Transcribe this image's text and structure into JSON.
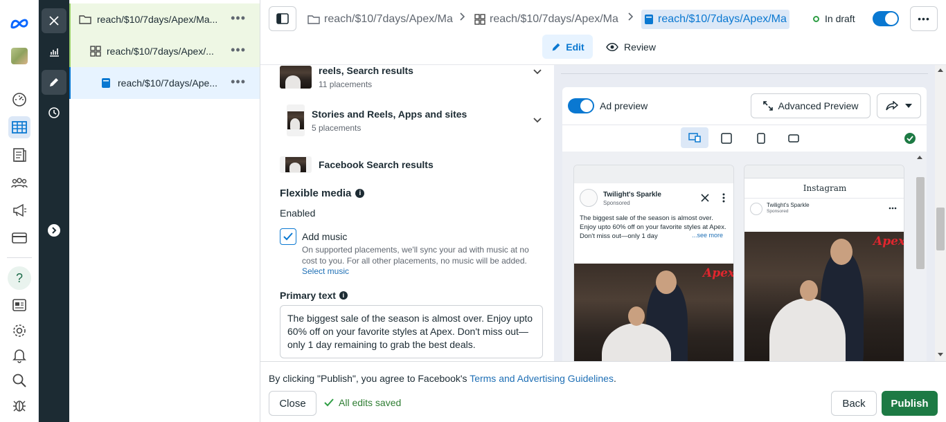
{
  "rail": {
    "icons": [
      "meta-logo-icon",
      "account-avatar",
      "dashboard-icon",
      "campaigns-table-icon",
      "pages-icon",
      "audiences-icon",
      "ads-megaphone-icon",
      "billing-card-icon",
      "help-icon",
      "news-icon",
      "settings-icon",
      "notifications-icon",
      "search-icon",
      "bug-report-icon"
    ],
    "help_glyph": "?"
  },
  "tree": {
    "items": [
      {
        "label": "reach/$10/7days/Apex/Ma...",
        "icon": "folder-icon"
      },
      {
        "label": "reach/$10/7days/Apex/...",
        "icon": "adset-grid-icon"
      },
      {
        "label": "reach/$10/7days/Ape...",
        "icon": "ad-icon"
      }
    ],
    "more": "•••"
  },
  "topbar": {
    "crumbs": [
      {
        "label": "reach/$10/7days/Apex/Ma",
        "icon": "folder-icon"
      },
      {
        "label": "reach/$10/7days/Apex/Ma",
        "icon": "adset-grid-icon"
      },
      {
        "label": "reach/$10/7days/Apex/Ma",
        "icon": "ad-icon"
      }
    ],
    "status": "In draft",
    "status_color": "#2e9e44",
    "more": "•••",
    "tabs": [
      {
        "label": "Edit",
        "active": true
      },
      {
        "label": "Review",
        "active": false
      }
    ]
  },
  "placements": [
    {
      "title": "reels, Search results",
      "sub": "11 placements"
    },
    {
      "title": "Stories and Reels, Apps and sites",
      "sub": "5 placements"
    },
    {
      "title": "Facebook Search results",
      "sub": ""
    }
  ],
  "flexible_media": {
    "title": "Flexible media",
    "value": "Enabled",
    "music_label": "Add music",
    "music_checked": true,
    "music_desc": "On supported placements, we'll sync your ad with music at no cost to you. For all other placements, no music will be added.",
    "music_link": "Select music"
  },
  "primary_text": {
    "label": "Primary text",
    "value": "The biggest sale of the season is almost over. Enjoy upto 60% off on your favorite styles at Apex. Don't miss out—only 1 day remaining to grab the best deals."
  },
  "preview": {
    "toggle_label": "Ad preview",
    "advanced_label": "Advanced Preview",
    "fb": {
      "page": "Twilight's Sparkle",
      "sponsored": "Sponsored",
      "text": "The biggest sale of the season is almost over. Enjoy upto 60% off on your favorite styles at Apex. Don't miss out—only 1 day",
      "see_more": "...see more",
      "brand": "Apex"
    },
    "ig": {
      "header": "Instagram",
      "page": "Twilight's Sparkle",
      "sponsored": "Sponsored",
      "brand": "Apex"
    }
  },
  "footer": {
    "terms_prefix": "By clicking \"Publish\", you agree to Facebook's",
    "terms_link": "Terms and Advertising Guidelines",
    "terms_suffix": ".",
    "close": "Close",
    "saved": "All edits saved",
    "back": "Back",
    "publish": "Publish"
  },
  "colors": {
    "accent": "#0a78d1",
    "publish": "#1d7a44",
    "link": "#1e6fb5",
    "tree_first_bg": "#eef7e4",
    "tree_selected_bg": "#e7f3ff"
  }
}
